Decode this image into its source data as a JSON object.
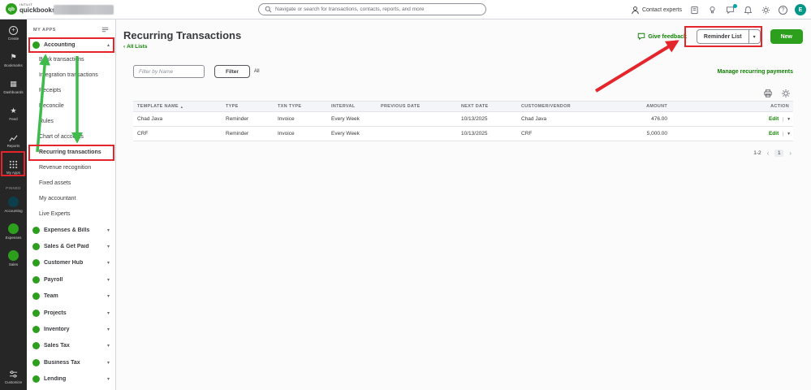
{
  "header": {
    "qb_monogram": "qb",
    "brand_top": "INTUIT",
    "brand_bottom": "quickbooks",
    "search_placeholder": "Navigate or search for transactions, contacts, reports, and more",
    "contact_experts": "Contact experts",
    "avatar_initial": "E"
  },
  "rail": {
    "items": [
      {
        "label": "Create"
      },
      {
        "label": "Bookmarks"
      },
      {
        "label": "Dashboards"
      },
      {
        "label": "Feed"
      },
      {
        "label": "Reports"
      },
      {
        "label": "My Apps"
      }
    ],
    "pinned_label": "PINNED",
    "pinned": [
      {
        "label": "Accounting"
      },
      {
        "label": "Expenses"
      },
      {
        "label": "Sales"
      }
    ],
    "customize": "Customize"
  },
  "sidebar": {
    "title": "MY APPS",
    "accounting": "Accounting",
    "accounting_children": [
      "Bank transactions",
      "Integration transactions",
      "Receipts",
      "Reconcile",
      "Rules",
      "Chart of accounts",
      "Recurring transactions",
      "Revenue recognition",
      "Fixed assets",
      "My accountant",
      "Live Experts"
    ],
    "groups": [
      "Expenses & Bills",
      "Sales & Get Paid",
      "Customer Hub",
      "Payroll",
      "Team",
      "Projects",
      "Inventory",
      "Sales Tax",
      "Business Tax",
      "Lending"
    ]
  },
  "main": {
    "title": "Recurring Transactions",
    "back_link": "All Lists",
    "give_feedback": "Give feedback",
    "reminder_list_button": "Reminder List",
    "new_button": "New",
    "filter_placeholder": "Filter by Name",
    "filter_button": "Filter",
    "filter_scope": "All",
    "manage_link": "Manage recurring payments",
    "table": {
      "columns": [
        "TEMPLATE NAME",
        "TYPE",
        "TXN TYPE",
        "INTERVAL",
        "PREVIOUS DATE",
        "NEXT DATE",
        "CUSTOMER/VENDOR",
        "AMOUNT",
        "ACTION"
      ],
      "rows": [
        {
          "cells": [
            "Chad Java",
            "Reminder",
            "Invoice",
            "Every Week",
            "",
            "10/13/2025",
            "Chad Java",
            "476.00",
            "Edit"
          ]
        },
        {
          "cells": [
            "CRF",
            "Reminder",
            "Invoice",
            "Every Week",
            "",
            "10/13/2025",
            "CRF",
            "5,000.00",
            "Edit"
          ]
        }
      ],
      "range_label": "1-2",
      "page": "1"
    }
  },
  "icons": {
    "plus": "+",
    "bookmark_flag": "⚑",
    "dashboard_grid": "▦",
    "feed_star": "★",
    "back_chevron": "‹",
    "chevron_up": "▴",
    "chevron_down": "▾",
    "chevron_left": "‹",
    "chevron_right": "›",
    "sort_asc": "▲",
    "help": "?"
  },
  "colors": {
    "brand_green": "#2ca01c",
    "link_green": "#108000",
    "annotation_red": "#e4262c",
    "annotation_green": "#3dbb4b",
    "rail_background": "#262626",
    "text_primary": "#393a3d",
    "text_secondary": "#6b6c72",
    "border": "#d4d7dc",
    "table_header_bg": "#f4f5f8"
  }
}
